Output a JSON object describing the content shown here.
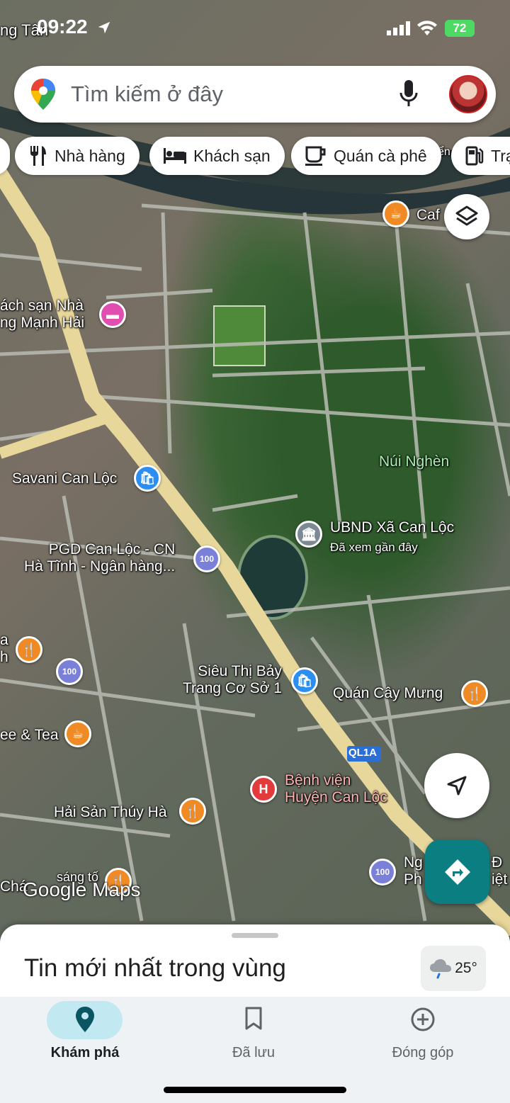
{
  "status_bar": {
    "time": "09:22",
    "battery": "72",
    "bg_label": "ng Tân"
  },
  "search": {
    "placeholder": "Tìm kiếm ở đây"
  },
  "chips": [
    {
      "label": "Nhà hàng",
      "icon": "restaurant-icon"
    },
    {
      "label": "Khách sạn",
      "icon": "hotel-icon"
    },
    {
      "label": "Quán cà phê",
      "icon": "coffee-icon"
    },
    {
      "label": "Trạ",
      "icon": "gas-station-icon"
    }
  ],
  "map": {
    "road_label": "QL1A",
    "watermark": "Google Maps",
    "places": [
      {
        "name": "Caf",
        "icon": "coffee-icon"
      },
      {
        "name": "ách sạn Nhà\nng Mạnh Hải",
        "icon": "hotel-icon"
      },
      {
        "name": "Núi Nghèn",
        "icon": ""
      },
      {
        "name": "Savani Can Lộc",
        "icon": "shopping-icon"
      },
      {
        "name": "UBND Xã Can Lộc",
        "subtitle": "Đã xem gần đây",
        "icon": "government-icon"
      },
      {
        "name": "PGD Can Lộc - CN\nHà Tĩnh - Ngân hàng...",
        "icon": "bank-icon"
      },
      {
        "name": "a\nh",
        "icon": "restaurant-icon"
      },
      {
        "name": "Siêu Thị Bảy\nTrang Cơ Sở 1",
        "icon": "shopping-icon"
      },
      {
        "name": "Quán Cây Mưng",
        "icon": "restaurant-icon"
      },
      {
        "name": "ee & Tea",
        "icon": "coffee-icon"
      },
      {
        "name": "Bệnh viện\nHuyện Can Lộc",
        "icon": "hospital-icon"
      },
      {
        "name": "Hải Sản Thúy Hà",
        "icon": "restaurant-icon"
      },
      {
        "name": "Ng\nPh",
        "icon": "bank-icon"
      },
      {
        "name": "Đ\niệt",
        "icon": ""
      },
      {
        "name": "Chá",
        "icon": ""
      },
      {
        "name": "sáng tố",
        "icon": "restaurant-icon"
      },
      {
        "name": "ển",
        "icon": ""
      }
    ]
  },
  "sheet": {
    "title": "Tin mới nhất trong vùng",
    "temperature": "25°"
  },
  "nav": [
    {
      "label": "Khám phá",
      "icon": "explore-pin-icon",
      "active": true
    },
    {
      "label": "Đã lưu",
      "icon": "bookmark-icon",
      "active": false
    },
    {
      "label": "Đóng góp",
      "icon": "add-circle-icon",
      "active": false
    }
  ]
}
